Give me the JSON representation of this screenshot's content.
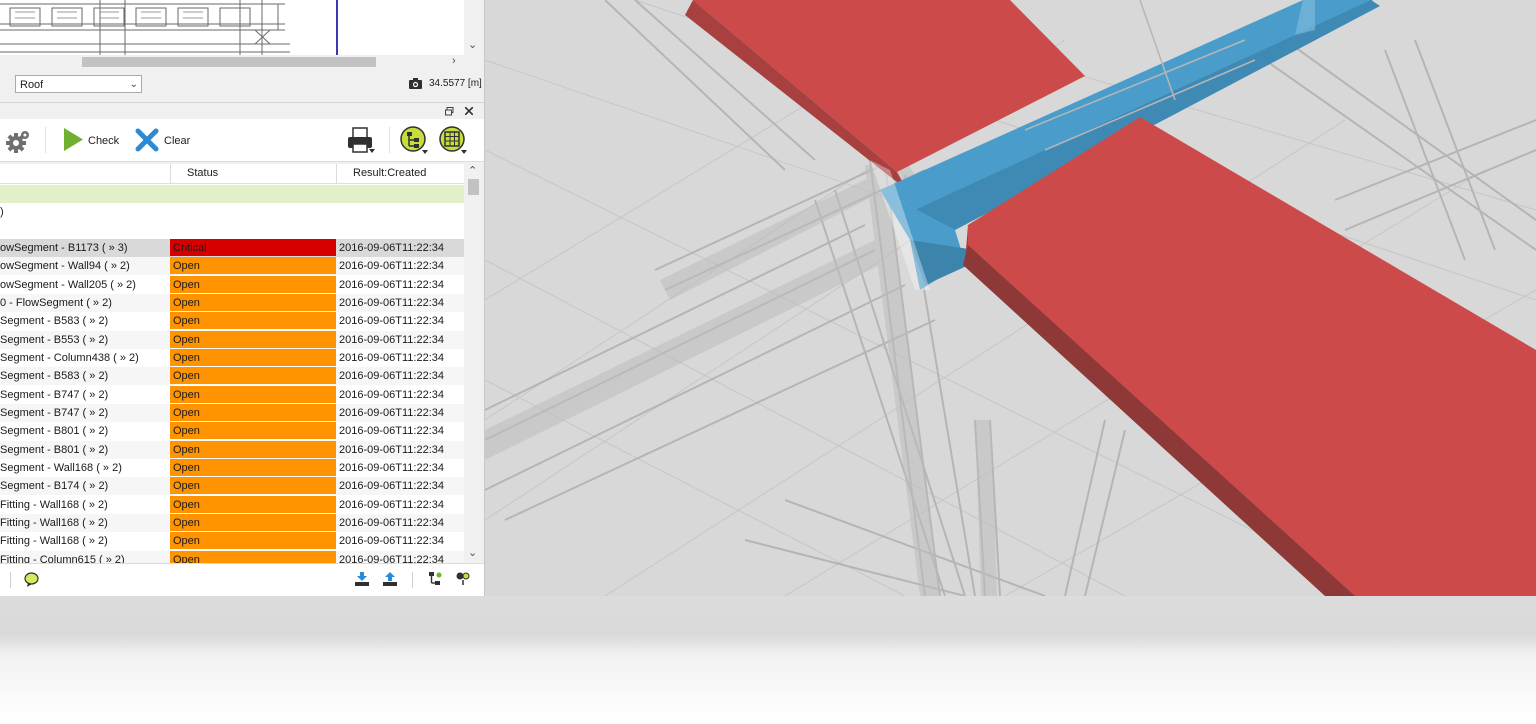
{
  "colors": {
    "critical": "#d60000",
    "open": "#ff9300",
    "group_highlight": "#e1f0c8",
    "selected_row": "#d9d9d9",
    "clash_red": "#cc4a4a",
    "duct_blue": "#4a9dcb"
  },
  "level": {
    "selected": "Roof",
    "elevation": "34.5577 [m]"
  },
  "toolbar": {
    "settings_icon": "gear-icon",
    "check_label": "Check",
    "clear_label": "Clear",
    "print_icon": "printer-icon"
  },
  "grid": {
    "columns": [
      "Status",
      "Result:Created"
    ],
    "group_text": ")",
    "rows": [
      {
        "name": "owSegment - B1173 ( » 3)",
        "status": "Critical",
        "created": "2016-09-06T11:22:34",
        "selected": true
      },
      {
        "name": "owSegment - Wall94 ( » 2)",
        "status": "Open",
        "created": "2016-09-06T11:22:34"
      },
      {
        "name": "owSegment - Wall205 ( » 2)",
        "status": "Open",
        "created": "2016-09-06T11:22:34"
      },
      {
        "name": "0 - FlowSegment ( » 2)",
        "status": "Open",
        "created": "2016-09-06T11:22:34"
      },
      {
        "name": "Segment - B583 ( » 2)",
        "status": "Open",
        "created": "2016-09-06T11:22:34"
      },
      {
        "name": "Segment - B553 ( » 2)",
        "status": "Open",
        "created": "2016-09-06T11:22:34"
      },
      {
        "name": "Segment - Column438 ( » 2)",
        "status": "Open",
        "created": "2016-09-06T11:22:34"
      },
      {
        "name": "Segment - B583 ( » 2)",
        "status": "Open",
        "created": "2016-09-06T11:22:34"
      },
      {
        "name": "Segment - B747 ( » 2)",
        "status": "Open",
        "created": "2016-09-06T11:22:34"
      },
      {
        "name": "Segment - B747 ( » 2)",
        "status": "Open",
        "created": "2016-09-06T11:22:34"
      },
      {
        "name": "Segment - B801 ( » 2)",
        "status": "Open",
        "created": "2016-09-06T11:22:34"
      },
      {
        "name": "Segment - B801 ( » 2)",
        "status": "Open",
        "created": "2016-09-06T11:22:34"
      },
      {
        "name": "Segment - Wall168 ( » 2)",
        "status": "Open",
        "created": "2016-09-06T11:22:34"
      },
      {
        "name": "Segment - B174 ( » 2)",
        "status": "Open",
        "created": "2016-09-06T11:22:34"
      },
      {
        "name": "Fitting - Wall168 ( » 2)",
        "status": "Open",
        "created": "2016-09-06T11:22:34"
      },
      {
        "name": "Fitting - Wall168 ( » 2)",
        "status": "Open",
        "created": "2016-09-06T11:22:34"
      },
      {
        "name": "Fitting - Wall168 ( » 2)",
        "status": "Open",
        "created": "2016-09-06T11:22:34"
      },
      {
        "name": "Fitting - Column615 ( » 2)",
        "status": "Open",
        "created": "2016-09-06T11:22:34"
      }
    ]
  },
  "footer": {
    "icons": [
      "comment-icon",
      "import-icon",
      "export-icon",
      "tree-icon",
      "filter-icon"
    ]
  }
}
